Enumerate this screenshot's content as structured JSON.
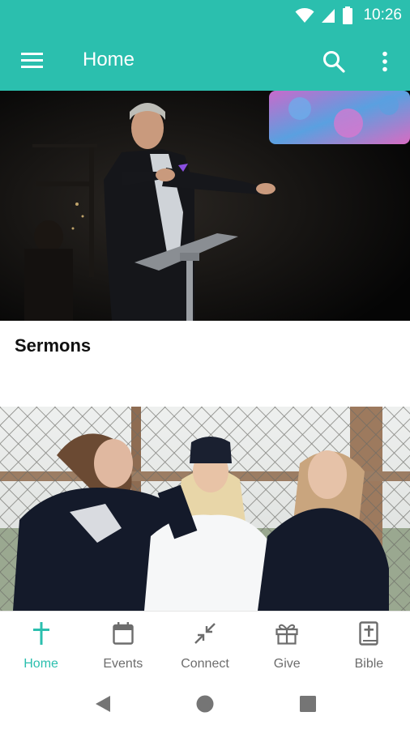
{
  "status_bar": {
    "time": "10:26",
    "icons": [
      "wifi-icon",
      "signal-icon",
      "battery-icon"
    ]
  },
  "app_bar": {
    "title": "Home",
    "icons": [
      "menu-icon",
      "search-icon",
      "more-vert-icon"
    ]
  },
  "cards": [
    {
      "title": "Sermons",
      "image": "preacher at pulpit on stage"
    },
    {
      "title": "",
      "image": "three young women by chain-link fence"
    }
  ],
  "bottom_nav": {
    "items": [
      {
        "label": "Home",
        "icon": "cross-icon",
        "active": true
      },
      {
        "label": "Events",
        "icon": "calendar-icon",
        "active": false
      },
      {
        "label": "Connect",
        "icon": "collapse-arrows-icon",
        "active": false
      },
      {
        "label": "Give",
        "icon": "gift-icon",
        "active": false
      },
      {
        "label": "Bible",
        "icon": "bible-icon",
        "active": false
      }
    ]
  },
  "system_nav": {
    "icons": [
      "back-icon",
      "home-circle-icon",
      "recents-icon"
    ]
  },
  "colors": {
    "primary": "#2bbfae",
    "inactive": "#6d6d6d",
    "text_dark": "#111111"
  }
}
